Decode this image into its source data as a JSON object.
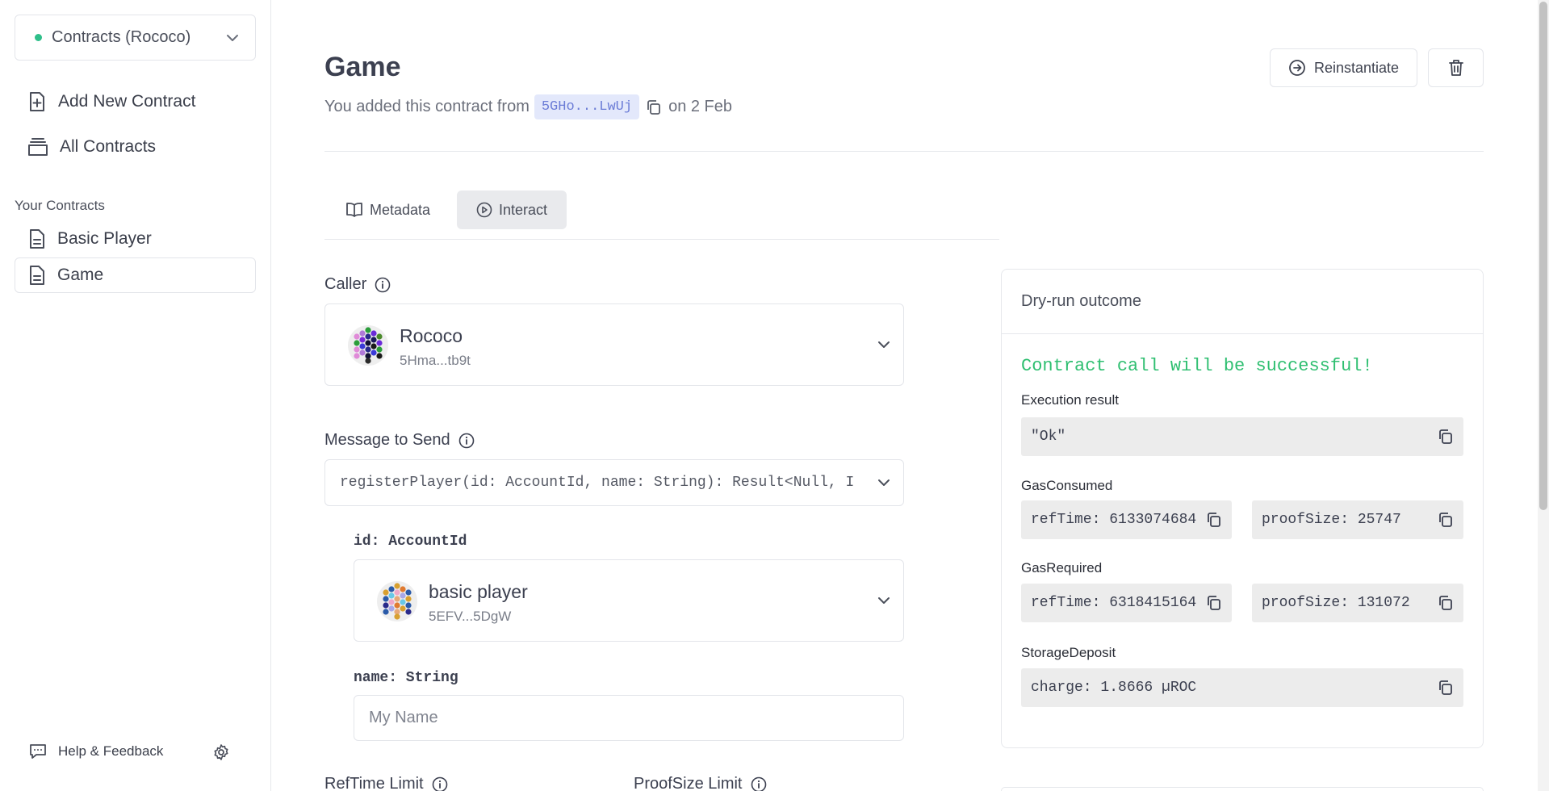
{
  "sidebar": {
    "network": "Contracts (Rococo)",
    "nav": {
      "add": "Add New Contract",
      "all": "All Contracts"
    },
    "section_label": "Your Contracts",
    "contracts": [
      "Basic Player",
      "Game"
    ],
    "help": "Help & Feedback"
  },
  "header": {
    "title": "Game",
    "subtitle_prefix": "You added this contract from",
    "address": "5GHo...LwUj",
    "subtitle_suffix": "on 2 Feb",
    "reinstantiate": "Reinstantiate"
  },
  "tabs": [
    "Metadata",
    "Interact"
  ],
  "caller": {
    "label": "Caller",
    "name": "Rococo",
    "address": "5Hma...tb9t"
  },
  "message": {
    "label": "Message to Send",
    "value": "registerPlayer(id: AccountId, name: String): Result<Null, I"
  },
  "params": {
    "id_label": "id: AccountId",
    "id_name": "basic player",
    "id_address": "5EFV...5DgW",
    "name_label": "name: String",
    "name_placeholder": "My Name"
  },
  "limits": {
    "reftime": "RefTime Limit",
    "proofsize": "ProofSize Limit"
  },
  "dryrun": {
    "title": "Dry-run outcome",
    "status": "Contract call will be successful!",
    "exec_label": "Execution result",
    "exec_value": "\"Ok\"",
    "gas_consumed_label": "GasConsumed",
    "gas_consumed_ref": "refTime: 6133074684",
    "gas_consumed_proof": "proofSize: 25747",
    "gas_required_label": "GasRequired",
    "gas_required_ref": "refTime: 6318415164",
    "gas_required_proof": "proofSize: 131072",
    "storage_label": "StorageDeposit",
    "storage_value": "charge: 1.8666 µROC"
  }
}
